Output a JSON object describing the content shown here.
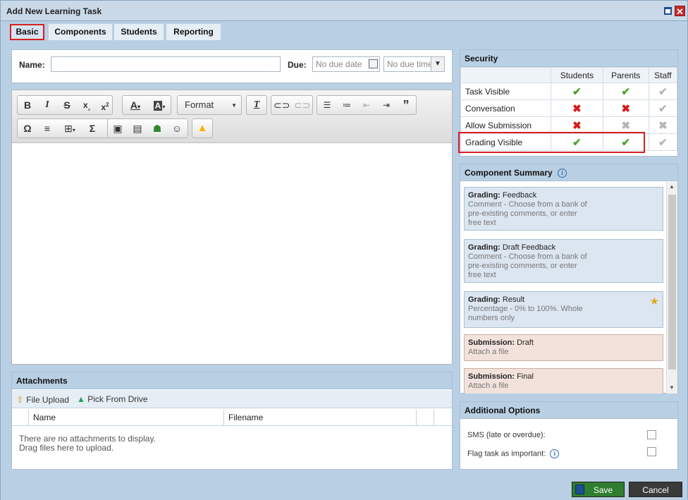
{
  "window": {
    "title": "Add New Learning Task"
  },
  "tabs": [
    {
      "label": "Basic",
      "active": true
    },
    {
      "label": "Components"
    },
    {
      "label": "Students"
    },
    {
      "label": "Reporting"
    }
  ],
  "form": {
    "name_label": "Name:",
    "name_value": "",
    "due_label": "Due:",
    "due_date_placeholder": "No due date",
    "due_time_placeholder": "No due time"
  },
  "editor": {
    "format_label": "Format"
  },
  "attachments": {
    "title": "Attachments",
    "file_upload": "File Upload",
    "pick_drive": "Pick From Drive",
    "col_name": "Name",
    "col_filename": "Filename",
    "empty_line1": "There are no attachments to display.",
    "empty_line2": "Drag files here to upload."
  },
  "security": {
    "title": "Security",
    "columns": [
      "Students",
      "Parents",
      "Staff"
    ],
    "rows": [
      {
        "label": "Task Visible",
        "students": "yes",
        "parents": "yes",
        "staff": "check-disabled"
      },
      {
        "label": "Conversation",
        "students": "no",
        "parents": "no",
        "staff": "check-disabled"
      },
      {
        "label": "Allow Submission",
        "students": "no",
        "parents": "x-disabled",
        "staff": "x-disabled"
      },
      {
        "label": "Grading Visible",
        "students": "yes",
        "parents": "yes",
        "staff": "check-disabled"
      }
    ]
  },
  "summary": {
    "title": "Component Summary",
    "cards": [
      {
        "type": "Grading:",
        "name": "Feedback",
        "desc1": "Comment - Choose from a bank of",
        "desc2": "pre-existing comments, or enter",
        "desc3": "free text",
        "color": "blue"
      },
      {
        "type": "Grading:",
        "name": "Draft Feedback",
        "desc1": "Comment - Choose from a bank of",
        "desc2": "pre-existing comments, or enter",
        "desc3": "free text",
        "color": "blue"
      },
      {
        "type": "Grading:",
        "name": "Result",
        "desc1": "Percentage - 0% to 100%. Whole",
        "desc2": "numbers only",
        "starred": true,
        "color": "blue"
      },
      {
        "type": "Submission:",
        "name": "Draft",
        "desc1": "Attach a file",
        "color": "pink"
      },
      {
        "type": "Submission:",
        "name": "Final",
        "desc1": "Attach a file",
        "color": "pink"
      }
    ]
  },
  "additional": {
    "title": "Additional Options",
    "sms_label": "SMS (late or overdue):",
    "flag_label": "Flag task as important:"
  },
  "actions": {
    "save": "Save",
    "cancel": "Cancel"
  },
  "colors": {
    "accent": "#b9cfe3",
    "yes": "#4aa22b",
    "no": "#d51b1b",
    "save_bg": "#2f7d2f",
    "highlight": "#d92020"
  }
}
